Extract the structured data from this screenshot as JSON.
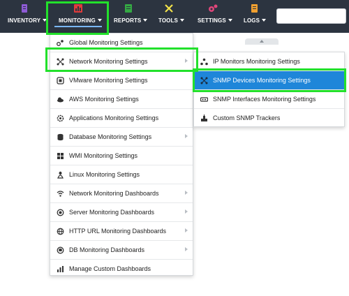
{
  "nav": {
    "items": [
      {
        "label": "INVENTORY",
        "icon": "inventory-book-icon",
        "color": "#8e5bd6"
      },
      {
        "label": "MONITORING",
        "icon": "monitoring-chart-icon",
        "color": "#e03b3b"
      },
      {
        "label": "REPORTS",
        "icon": "reports-icon",
        "color": "#35a844"
      },
      {
        "label": "TOOLS",
        "icon": "tools-icon",
        "color": "#f2e24a"
      },
      {
        "label": "SETTINGS",
        "icon": "settings-gears-icon",
        "color": "#e0467a"
      },
      {
        "label": "LOGS",
        "icon": "logs-icon",
        "color": "#f0a030"
      }
    ]
  },
  "search": {
    "placeholder": ""
  },
  "monitoring_menu": {
    "items": [
      {
        "label": "Global Monitoring Settings",
        "icon": "global-settings-icon",
        "submenu": false
      },
      {
        "label": "Network Monitoring Settings",
        "icon": "network-icon",
        "submenu": true
      },
      {
        "label": "VMware Monitoring Settings",
        "icon": "vmware-icon",
        "submenu": false
      },
      {
        "label": "AWS Monitoring Settings",
        "icon": "cloud-icon",
        "submenu": false
      },
      {
        "label": "Applications Monitoring Settings",
        "icon": "applications-gear-icon",
        "submenu": false
      },
      {
        "label": "Database Monitoring Settings",
        "icon": "database-icon",
        "submenu": true
      },
      {
        "label": "WMI Monitoring Settings",
        "icon": "windows-icon",
        "submenu": false
      },
      {
        "label": "Linux Monitoring Settings",
        "icon": "linux-icon",
        "submenu": false
      },
      {
        "label": "Network Monitoring Dashboards",
        "icon": "wifi-icon",
        "submenu": true
      },
      {
        "label": "Server Monitoring Dashboards",
        "icon": "server-globe-icon",
        "submenu": true
      },
      {
        "label": "HTTP URL Monitoring Dashboards",
        "icon": "globe-icon",
        "submenu": true
      },
      {
        "label": "DB Monitoring Dashboards",
        "icon": "database-icon",
        "submenu": true
      },
      {
        "label": "Manage Custom Dashboards",
        "icon": "bar-chart-icon",
        "submenu": false
      }
    ]
  },
  "network_submenu": {
    "items": [
      {
        "label": "IP Monitors Monitoring Settings",
        "icon": "ip-network-icon",
        "active": false
      },
      {
        "label": "SNMP Devices Monitoring Settings",
        "icon": "snmp-devices-icon",
        "active": true
      },
      {
        "label": "SNMP Interfaces Monitoring Settings",
        "icon": "interface-icon",
        "active": false
      },
      {
        "label": "Custom SNMP Trackers",
        "icon": "tracker-icon",
        "active": false
      }
    ]
  },
  "colors": {
    "topbar": "#2c3440",
    "highlight": "#22e12b",
    "active_item": "#1f86d9"
  }
}
